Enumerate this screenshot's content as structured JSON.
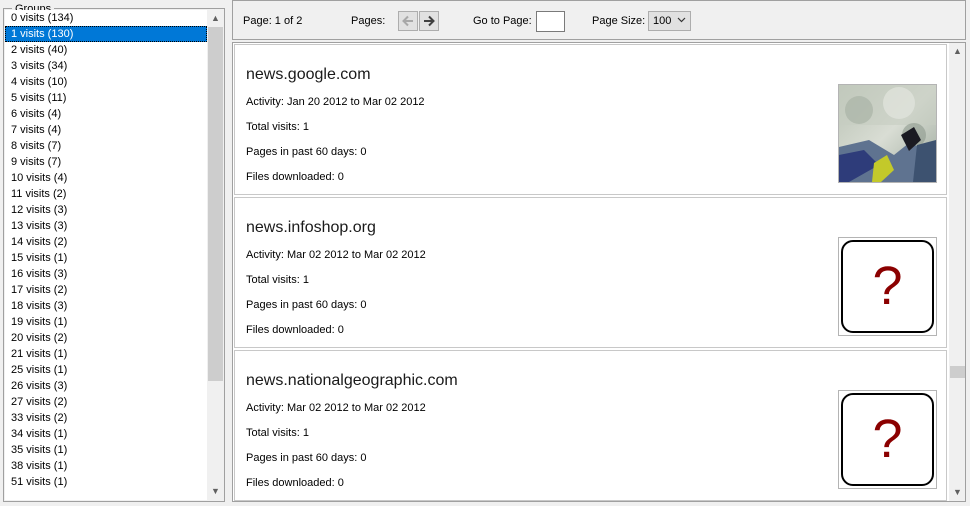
{
  "groups": {
    "title": "Groups",
    "items": [
      {
        "label": "0 visits (134)"
      },
      {
        "label": "1 visits (130)"
      },
      {
        "label": "2 visits (40)"
      },
      {
        "label": "3 visits (34)"
      },
      {
        "label": "4 visits (10)"
      },
      {
        "label": "5 visits (11)"
      },
      {
        "label": "6 visits (4)"
      },
      {
        "label": "7 visits (4)"
      },
      {
        "label": "8 visits (7)"
      },
      {
        "label": "9 visits (7)"
      },
      {
        "label": "10 visits (4)"
      },
      {
        "label": "11 visits (2)"
      },
      {
        "label": "12 visits (3)"
      },
      {
        "label": "13 visits (3)"
      },
      {
        "label": "14 visits (2)"
      },
      {
        "label": "15 visits (1)"
      },
      {
        "label": "16 visits (3)"
      },
      {
        "label": "17 visits (2)"
      },
      {
        "label": "18 visits (3)"
      },
      {
        "label": "19 visits (1)"
      },
      {
        "label": "20 visits (2)"
      },
      {
        "label": "21 visits (1)"
      },
      {
        "label": "25 visits (1)"
      },
      {
        "label": "26 visits (3)"
      },
      {
        "label": "27 visits (2)"
      },
      {
        "label": "33 visits (2)"
      },
      {
        "label": "34 visits (1)"
      },
      {
        "label": "35 visits (1)"
      },
      {
        "label": "38 visits (1)"
      },
      {
        "label": "51 visits (1)"
      }
    ],
    "selected_label": "1 visits (130)"
  },
  "toolbar": {
    "page_info": "Page: 1 of 2",
    "pages_label": "Pages:",
    "goto_label": "Go to Page:",
    "goto_value": "",
    "pagesize_label": "Page Size:",
    "pagesize_value": "100"
  },
  "results": [
    {
      "domain": "news.google.com",
      "activity": "Activity: Jan 20 2012 to Mar 02 2012",
      "total_visits": "Total visits: 1",
      "pages_past": "Pages in past 60 days: 0",
      "files_downloaded": "Files downloaded: 0",
      "thumbnail": "site-screenshot"
    },
    {
      "domain": "news.infoshop.org",
      "activity": "Activity: Mar 02 2012 to Mar 02 2012",
      "total_visits": "Total visits: 1",
      "pages_past": "Pages in past 60 days: 0",
      "files_downloaded": "Files downloaded: 0",
      "thumbnail": "question-mark-icon",
      "thumb_glyph": "?"
    },
    {
      "domain": "news.nationalgeographic.com",
      "activity": "Activity: Mar 02 2012 to Mar 02 2012",
      "total_visits": "Total visits: 1",
      "pages_past": "Pages in past 60 days: 0",
      "files_downloaded": "Files downloaded: 0",
      "thumbnail": "question-mark-icon",
      "thumb_glyph": "?"
    }
  ],
  "colors": {
    "selection": "#0078d7",
    "question_mark": "#8b0000"
  }
}
